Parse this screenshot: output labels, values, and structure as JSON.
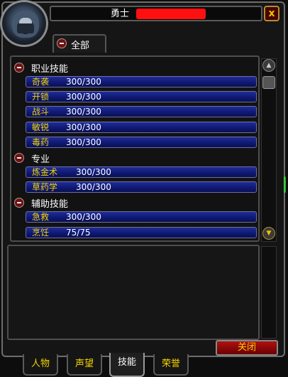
{
  "window": {
    "title_label": "勇士",
    "close_glyph": "x"
  },
  "filter": {
    "label": "全部"
  },
  "categories": [
    {
      "label": "职业技能",
      "skills": [
        {
          "name": "奇袭",
          "rank": "300/300"
        },
        {
          "name": "开锁",
          "rank": "300/300"
        },
        {
          "name": "战斗",
          "rank": "300/300"
        },
        {
          "name": "敏锐",
          "rank": "300/300"
        },
        {
          "name": "毒药",
          "rank": "300/300"
        }
      ]
    },
    {
      "label": "专业",
      "skills": [
        {
          "name": "炼金术",
          "rank": "300/300"
        },
        {
          "name": "草药学",
          "rank": "300/300"
        }
      ]
    },
    {
      "label": "辅助技能",
      "skills": [
        {
          "name": "急救",
          "rank": "300/300"
        },
        {
          "name": "烹饪",
          "rank": "75/75"
        }
      ]
    }
  ],
  "buttons": {
    "close": "关闭"
  },
  "tabs": [
    {
      "label": "人物",
      "active": false
    },
    {
      "label": "声望",
      "active": false
    },
    {
      "label": "技能",
      "active": true
    },
    {
      "label": "荣誉",
      "active": false
    }
  ],
  "icons": {
    "portrait": "hooded-character-portrait",
    "collapse": "minus-circle-icon",
    "scroll_up": "scroll-up-arrow-icon",
    "scroll_down": "scroll-down-arrow-icon"
  },
  "colors": {
    "skill_name": "#f2d200",
    "skill_bar": "#1e2c9a",
    "title_redaction": "#ff1010",
    "close_button": "#b01010"
  }
}
